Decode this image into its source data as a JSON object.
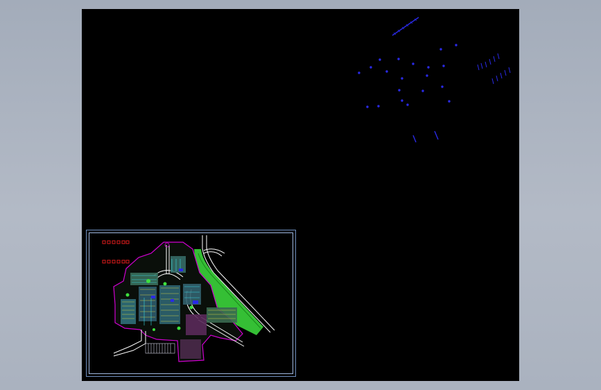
{
  "viewport": {
    "background": "#000000",
    "canvas_color": "#a6afbc"
  },
  "colors": {
    "frame": "#6f8fc0",
    "frame_inner": "#a0b8e0",
    "red_marks": "#e01c1c",
    "blue_annotations": "#2a2ae6",
    "green_area": "#3ee03e",
    "magenta_outline": "#d000d0",
    "cyan_lines": "#38d8e0",
    "yellow_lines": "#e8e040",
    "white_roads": "#ffffff"
  },
  "drawing": {
    "sheet_name": "site-plan-sheet",
    "legend_rows": 2,
    "legend_boxes_per_row": 5
  },
  "annotation_cluster": {
    "label_visible": true
  }
}
